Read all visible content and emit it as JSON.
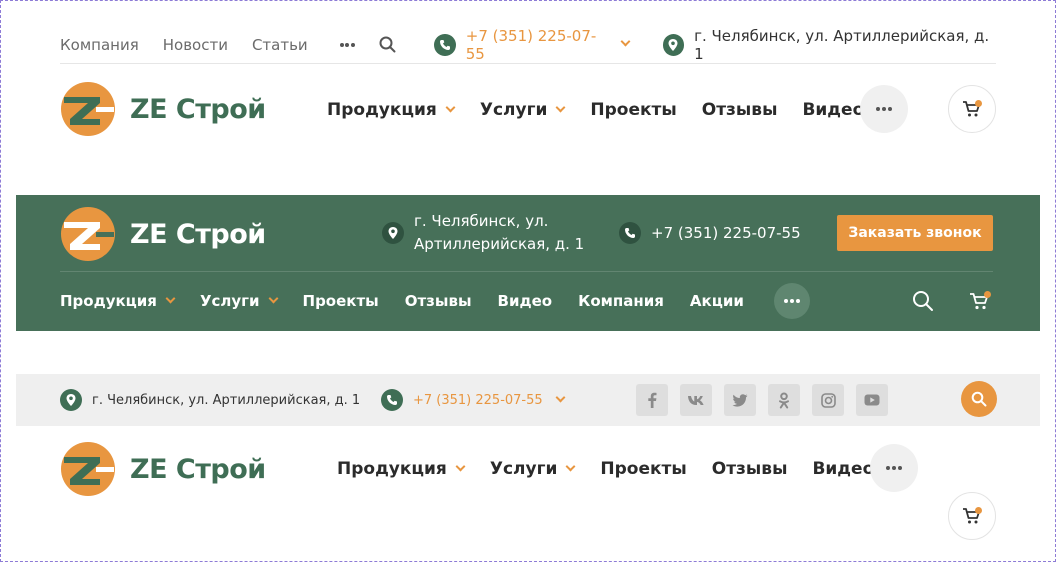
{
  "colors": {
    "brand_green": "#477059",
    "logo_green": "#3f6e55",
    "accent_orange": "#e89640",
    "text_dark": "#2b2b2b",
    "text_grey": "#6b6b6b",
    "grey_band": "#efefef"
  },
  "brand": {
    "name": "ZE Строй"
  },
  "header1": {
    "top_links": [
      "Компания",
      "Новости",
      "Статьи"
    ],
    "phone": "+7 (351) 225-07-55",
    "address": "г. Челябинск, ул. Артиллерийская, д. 1",
    "nav": [
      {
        "label": "Продукция",
        "dropdown": true
      },
      {
        "label": "Услуги",
        "dropdown": true
      },
      {
        "label": "Проекты",
        "dropdown": false
      },
      {
        "label": "Отзывы",
        "dropdown": false
      },
      {
        "label": "Видео",
        "dropdown": false
      }
    ],
    "icons": [
      "more-icon",
      "search-icon",
      "phone-icon",
      "location-icon",
      "cart-icon"
    ]
  },
  "header2": {
    "address_line1": "г. Челябинск, ул.",
    "address_line2": "Артиллерийская, д. 1",
    "phone": "+7 (351) 225-07-55",
    "order_button": "Заказать звонок",
    "nav": [
      {
        "label": "Продукция",
        "dropdown": true
      },
      {
        "label": "Услуги",
        "dropdown": true
      },
      {
        "label": "Проекты",
        "dropdown": false
      },
      {
        "label": "Отзывы",
        "dropdown": false
      },
      {
        "label": "Видео",
        "dropdown": false
      },
      {
        "label": "Компания",
        "dropdown": false
      },
      {
        "label": "Акции",
        "dropdown": false
      }
    ]
  },
  "header3": {
    "address": "г. Челябинск, ул. Артиллерийская, д. 1",
    "phone": "+7 (351) 225-07-55",
    "socials": [
      {
        "name": "facebook-icon",
        "glyph": "f"
      },
      {
        "name": "vk-icon",
        "glyph": "vk"
      },
      {
        "name": "twitter-icon",
        "glyph": "t"
      },
      {
        "name": "odnoklassniki-icon",
        "glyph": "ok"
      },
      {
        "name": "instagram-icon",
        "glyph": "ig"
      },
      {
        "name": "youtube-icon",
        "glyph": "yt"
      }
    ],
    "nav": [
      {
        "label": "Продукция",
        "dropdown": true
      },
      {
        "label": "Услуги",
        "dropdown": true
      },
      {
        "label": "Проекты",
        "dropdown": false
      },
      {
        "label": "Отзывы",
        "dropdown": false
      },
      {
        "label": "Видео",
        "dropdown": false
      }
    ]
  }
}
